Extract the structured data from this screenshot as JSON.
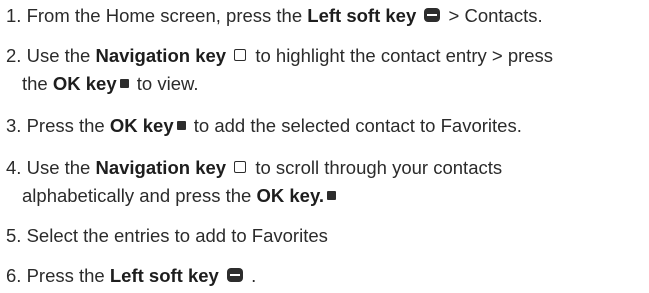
{
  "steps": [
    {
      "num": "1.",
      "a": "From the Home screen, press the ",
      "b": "Left soft key",
      "c": " > Contacts."
    },
    {
      "num": "2.",
      "a": "Use the ",
      "b": "Navigation key",
      "c": " to highlight the contact entry > press",
      "d": "the ",
      "e": "OK key",
      "f": " to view."
    },
    {
      "num": "3.",
      "a": "Press the ",
      "b": "OK key",
      "c": " to add the selected contact to Favorites."
    },
    {
      "num": "4.",
      "a": "Use the ",
      "b": "Navigation key",
      "c": " to scroll through your contacts",
      "d": "alphabetically and press the ",
      "e": "OK key."
    },
    {
      "num": "5.",
      "a": "Select the entries to add to Favorites"
    },
    {
      "num": "6.",
      "a": "Press the ",
      "b": "Left soft key",
      "c": " ."
    }
  ],
  "icons": {
    "left_soft_key": "left-soft-key-icon",
    "navigation_key": "navigation-key-icon",
    "ok_key": "ok-key-icon"
  }
}
